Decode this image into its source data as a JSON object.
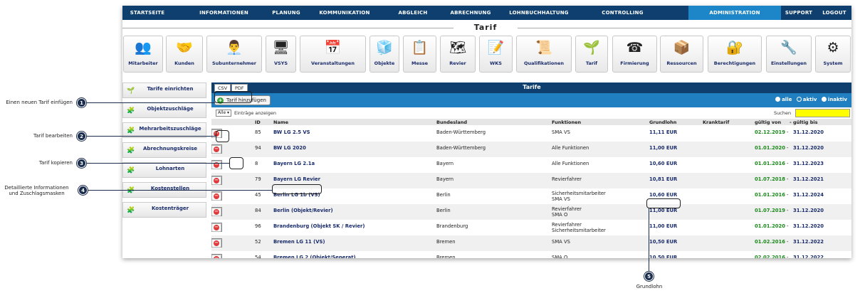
{
  "nav": {
    "items": [
      "STARTSEITE",
      "INFORMATIONEN",
      "PLANUNG",
      "KOMMUNIKATION",
      "ABGLEICH",
      "ABRECHNUNG",
      "LOHNBUCHHALTUNG",
      "CONTROLLING",
      "ADMINISTRATION",
      "SUPPORT",
      "LOGOUT"
    ],
    "active": "ADMINISTRATION"
  },
  "section_title": "Tarif",
  "tiles": [
    {
      "label": "Mitarbeiter",
      "icon": "employees-icon",
      "glyph": "👥"
    },
    {
      "label": "Kunden",
      "icon": "handshake-icon",
      "glyph": "🤝"
    },
    {
      "label": "Subunternehmer",
      "icon": "subcontractor-icon",
      "glyph": "👨‍💼"
    },
    {
      "label": "VSYS",
      "icon": "monitor-icon",
      "glyph": "🖥"
    },
    {
      "label": "Veranstaltungen",
      "icon": "calendar-icon",
      "glyph": "📅"
    },
    {
      "label": "Objekte",
      "icon": "cube-icon",
      "glyph": "🧊"
    },
    {
      "label": "Messe",
      "icon": "board-icon",
      "glyph": "📋"
    },
    {
      "label": "Revier",
      "icon": "map-icon",
      "glyph": "🗺"
    },
    {
      "label": "WKS",
      "icon": "checklist-icon",
      "glyph": "📝"
    },
    {
      "label": "Qualifikationen",
      "icon": "certificate-icon",
      "glyph": "📜"
    },
    {
      "label": "Tarif",
      "icon": "money-tree-icon",
      "glyph": "🌱"
    },
    {
      "label": "Firmierung",
      "icon": "phone-icon",
      "glyph": "☎"
    },
    {
      "label": "Ressourcen",
      "icon": "boxes-icon",
      "glyph": "📦"
    },
    {
      "label": "Berechtigungen",
      "icon": "permission-icon",
      "glyph": "🔐"
    },
    {
      "label": "Einstellungen",
      "icon": "wrench-icon",
      "glyph": "🔧"
    },
    {
      "label": "System",
      "icon": "gears-icon",
      "glyph": "⚙"
    }
  ],
  "sidebar": [
    {
      "label": "Tarife einrichten",
      "glyph": "🌱"
    },
    {
      "label": "Objektzuschläge",
      "glyph": "🧩"
    },
    {
      "label": "Mehrarbeitszuschläge",
      "glyph": "🧩"
    },
    {
      "label": "Abrechnungskreise",
      "glyph": "🧩"
    },
    {
      "label": "Lohnarten",
      "glyph": "🧩"
    },
    {
      "label": "Kostenstellen",
      "glyph": "🧩"
    },
    {
      "label": "Kostenträger",
      "glyph": "🧩"
    }
  ],
  "panel": {
    "csv": "CSV",
    "pdf": "PDF",
    "title": "Tarife",
    "add_button": "Tarif hinzufügen",
    "filter": [
      "alle",
      "aktiv",
      "inaktiv"
    ],
    "page_size": "Alle",
    "page_size_label": "Einträge anzeigen",
    "search_label": "Suchen",
    "search_value": ""
  },
  "columns": [
    "ID",
    "Name",
    "Bundesland",
    "Funktionen",
    "Grundlohn",
    "Kranktarif",
    "gültig von",
    "- gültig bis"
  ],
  "rows": [
    {
      "id": "85",
      "name": "BW LG 2.5 VS",
      "land": "Baden-Württemberg",
      "funktionen": [
        "SMA VS"
      ],
      "lohn": "11,11 EUR",
      "krank": "",
      "von": "02.12.2019",
      "bis": "31.12.2020"
    },
    {
      "id": "94",
      "name": "BW LG 2020",
      "land": "Baden-Württemberg",
      "funktionen": [
        "Alle Funktionen"
      ],
      "lohn": "11,00 EUR",
      "krank": "",
      "von": "01.01.2020",
      "bis": "31.12.2020"
    },
    {
      "id": "8",
      "name": "Bayern LG 2.1a",
      "land": "Bayern",
      "funktionen": [
        "Alle Funktionen"
      ],
      "lohn": "10,60 EUR",
      "krank": "",
      "von": "01.01.2016",
      "bis": "31.12.2023"
    },
    {
      "id": "79",
      "name": "Bayern LG Revier",
      "land": "Bayern",
      "funktionen": [
        "Revierfahrer"
      ],
      "lohn": "10,81 EUR",
      "krank": "",
      "von": "01.07.2018",
      "bis": "31.12.2021"
    },
    {
      "id": "45",
      "name": "Berlin LG 1b (VS)",
      "land": "Berlin",
      "funktionen": [
        "Sicherheitsmitarbeiter",
        "SMA VS"
      ],
      "lohn": "10,60 EUR",
      "krank": "",
      "von": "01.01.2016",
      "bis": "31.12.2024"
    },
    {
      "id": "84",
      "name": "Berlin (Objekt/Revier)",
      "land": "Berlin",
      "funktionen": [
        "Revierfahrer",
        "SMA O"
      ],
      "lohn": "11,00 EUR",
      "krank": "",
      "von": "01.07.2019",
      "bis": "31.12.2020"
    },
    {
      "id": "96",
      "name": "Brandenburg (Objekt SK / Revier)",
      "land": "Brandenburg",
      "funktionen": [
        "Revierfahrer",
        "Sicherheitsmitarbeiter"
      ],
      "lohn": "11,00 EUR",
      "krank": "",
      "von": "01.01.2020",
      "bis": "31.12.2020"
    },
    {
      "id": "52",
      "name": "Bremen LG 11 (VS)",
      "land": "Bremen",
      "funktionen": [
        "SMA VS"
      ],
      "lohn": "10,50 EUR",
      "krank": "",
      "von": "01.02.2016",
      "bis": "31.12.2022"
    },
    {
      "id": "54",
      "name": "Bremen LG 2 (Objekt/Seperat)",
      "land": "Bremen",
      "funktionen": [
        "SMA O"
      ],
      "lohn": "10,50 EUR",
      "krank": "",
      "von": "02.02.2016",
      "bis": "31.12.2022"
    }
  ],
  "annotations": [
    {
      "num": "1",
      "text": "Einen neuen Tarif einfügen"
    },
    {
      "num": "2",
      "text": "Tarif bearbeiten"
    },
    {
      "num": "3",
      "text": "Tarif kopieren"
    },
    {
      "num": "4",
      "text": "Detaillierte Informationen\nund Zuschlagsmasken"
    },
    {
      "num": "5",
      "text": "Grundlohn"
    }
  ]
}
